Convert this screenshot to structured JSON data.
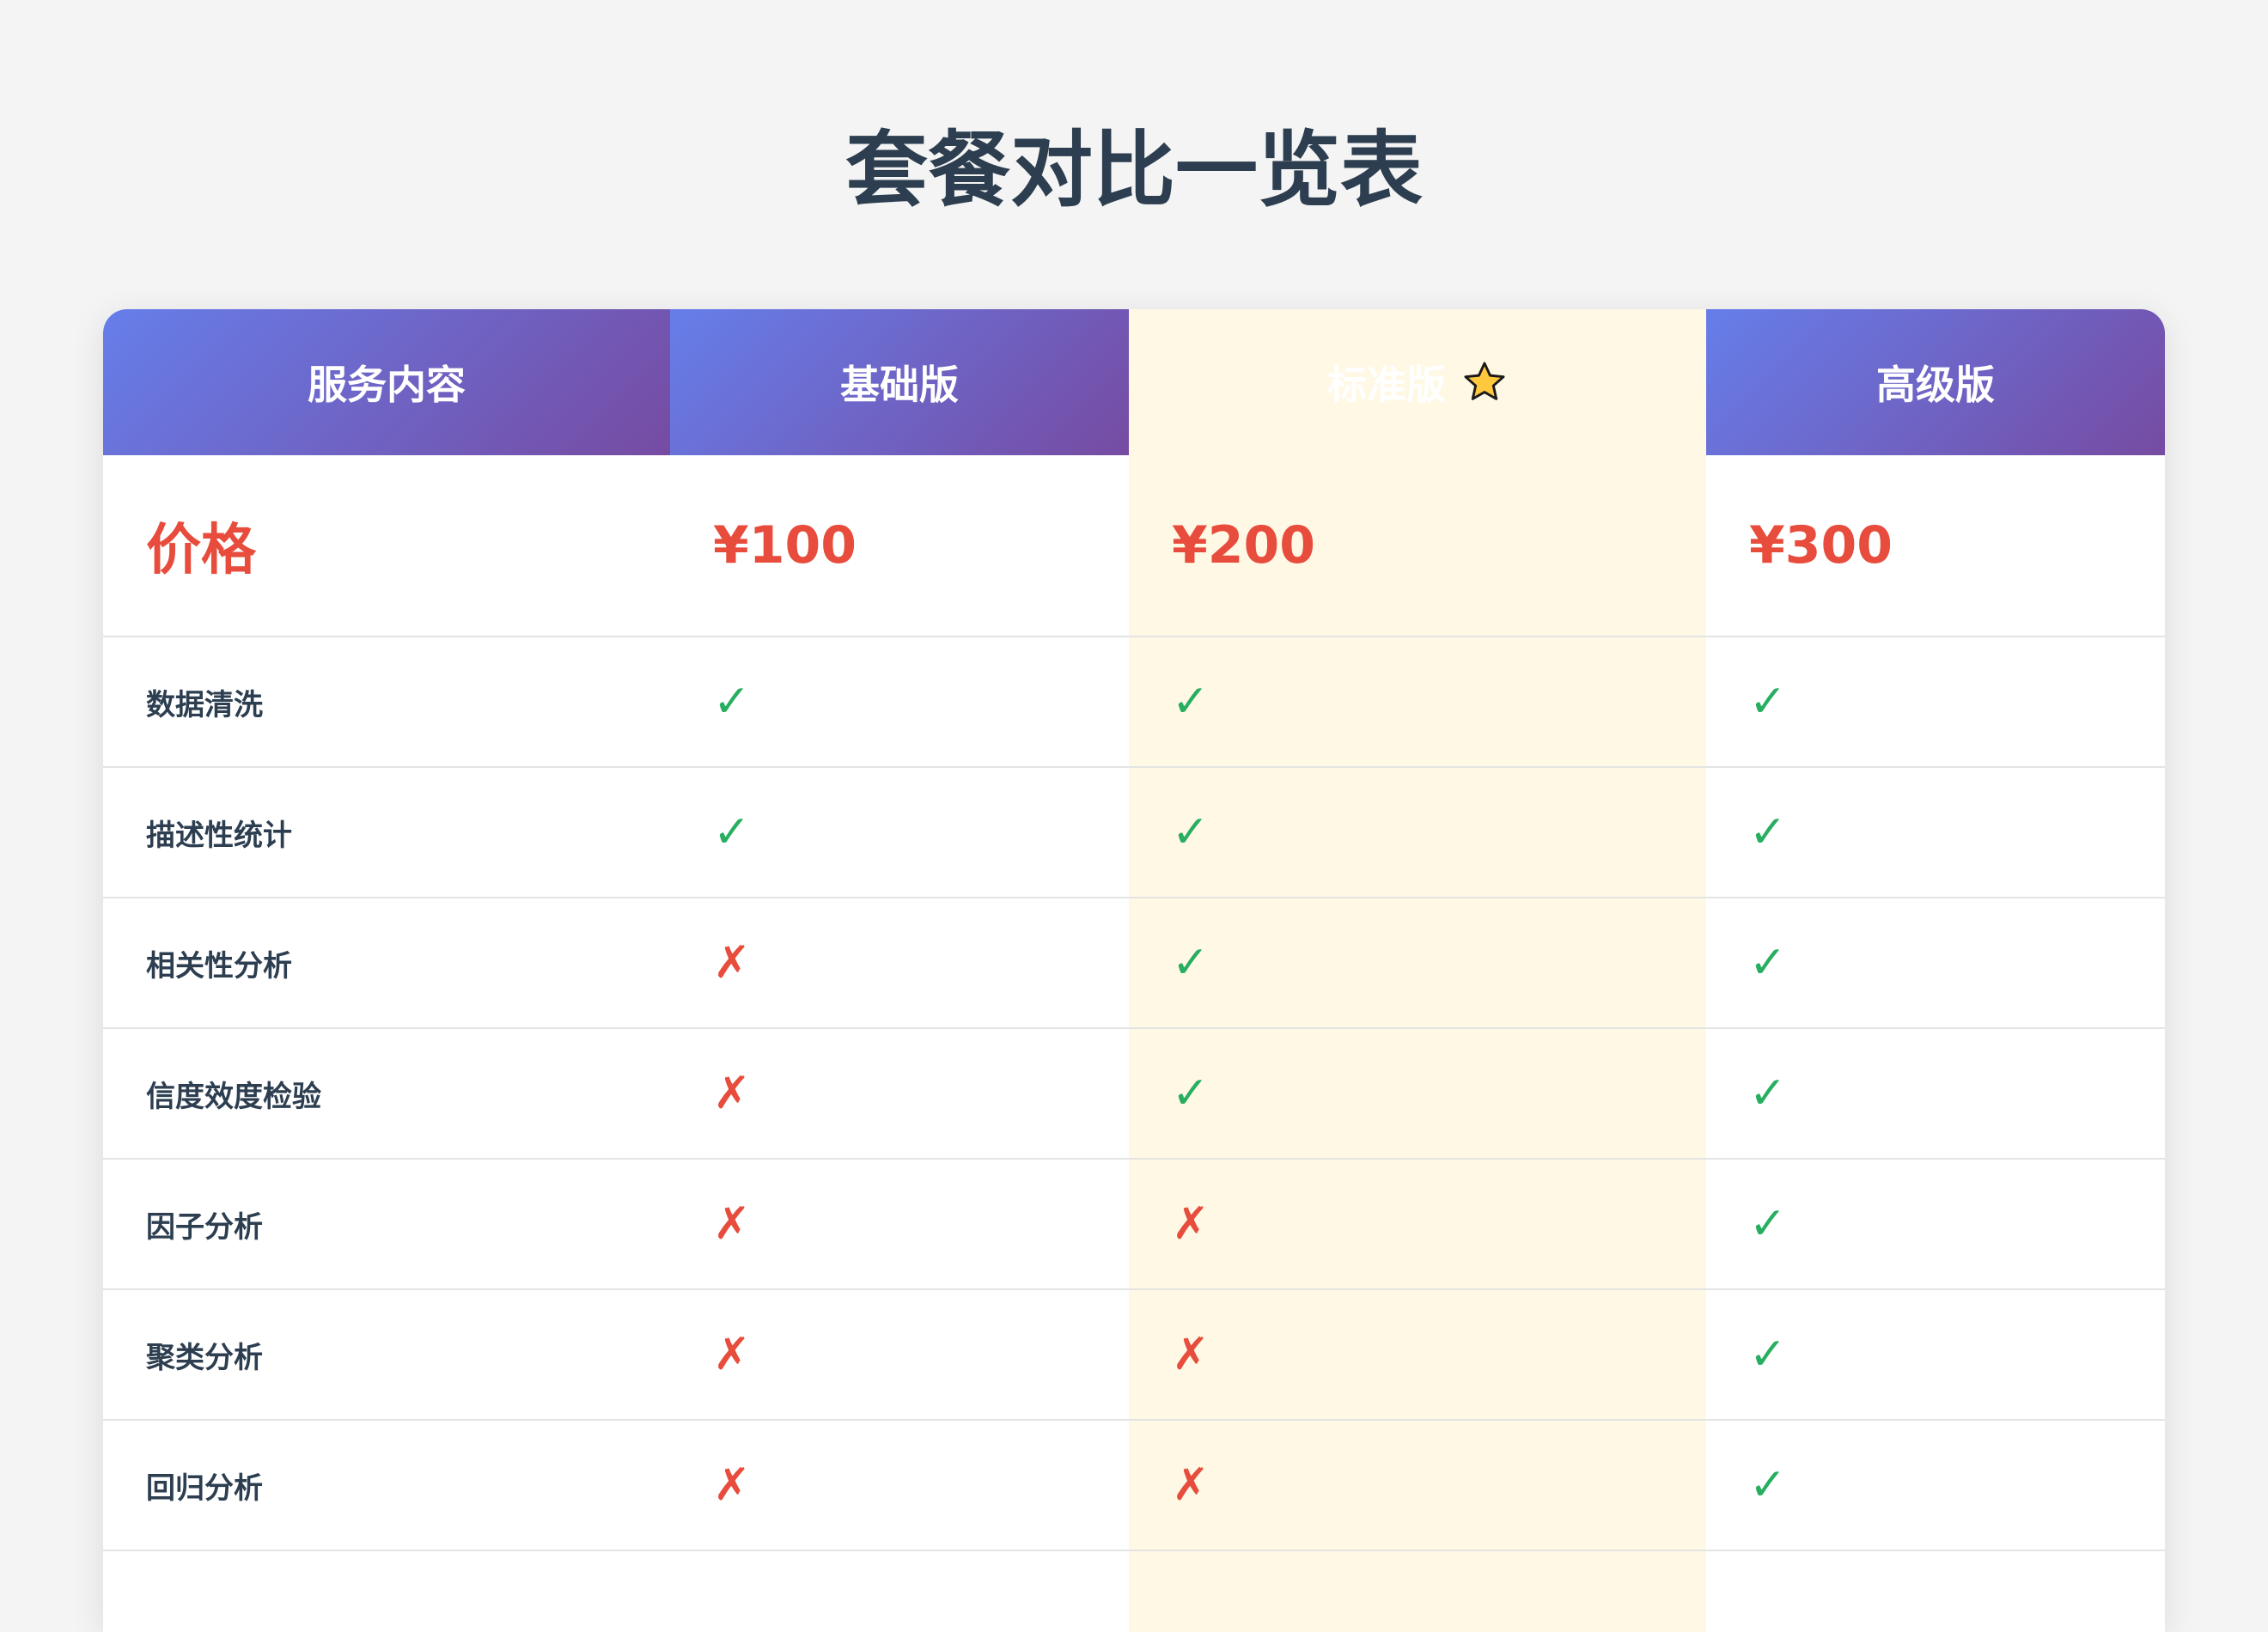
{
  "page": {
    "title": "套餐对比一览表"
  },
  "table": {
    "headers": [
      "服务内容",
      "基础版",
      "标准版",
      "高级版"
    ],
    "featured_icon": "star-icon",
    "price_row": {
      "label": "价格",
      "values": [
        "¥100",
        "¥200",
        "¥300"
      ]
    },
    "features": [
      {
        "label": "数据清洗",
        "marks": [
          "✓",
          "✓",
          "✓"
        ]
      },
      {
        "label": "描述性统计",
        "marks": [
          "✓",
          "✓",
          "✓"
        ]
      },
      {
        "label": "相关性分析",
        "marks": [
          "✗",
          "✓",
          "✓"
        ]
      },
      {
        "label": "信度效度检验",
        "marks": [
          "✗",
          "✓",
          "✓"
        ]
      },
      {
        "label": "因子分析",
        "marks": [
          "✗",
          "✗",
          "✓"
        ]
      },
      {
        "label": "聚类分析",
        "marks": [
          "✗",
          "✗",
          "✓"
        ]
      },
      {
        "label": "回归分析",
        "marks": [
          "✗",
          "✗",
          "✓"
        ]
      }
    ]
  },
  "colors": {
    "header_gradient_start": "#667eea",
    "header_gradient_end": "#764ba2",
    "featured_column": "#fff8e5",
    "price": "#e74c3c",
    "check": "#27ae60",
    "cross": "#e74c3c",
    "title": "#2c3e50"
  }
}
